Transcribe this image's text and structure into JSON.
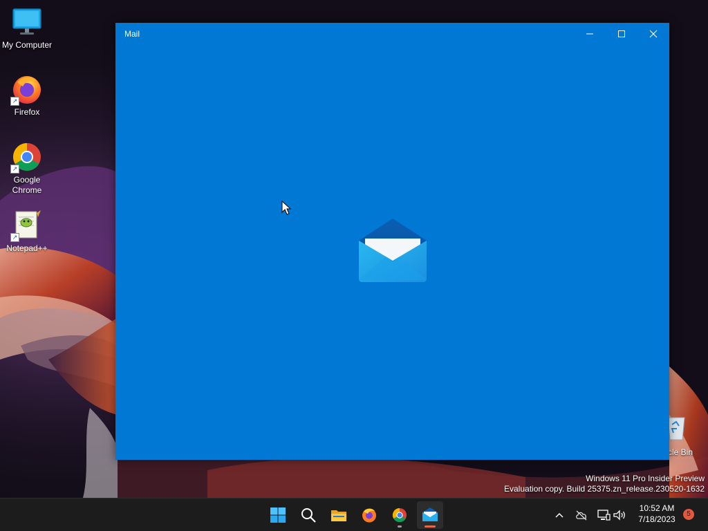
{
  "desktop": {
    "icons": [
      {
        "label": "My Computer",
        "icon": "monitor-icon"
      },
      {
        "label": "Firefox",
        "icon": "firefox-icon"
      },
      {
        "label": "Google\nChrome",
        "icon": "chrome-icon"
      },
      {
        "label": "Notepad++",
        "icon": "notepadpp-icon"
      }
    ],
    "recycle_bin_label": "ycle Bin"
  },
  "window": {
    "title": "Mail",
    "controls": [
      "minimize-icon",
      "maximize-icon",
      "close-icon"
    ],
    "background": "#0078d4"
  },
  "watermark": {
    "line1": "Windows 11 Pro Insider Preview",
    "line2": "Evaluation copy. Build 25375.zn_release.230520-1632"
  },
  "taskbar": {
    "apps": [
      "start-icon",
      "search-icon",
      "file-explorer-icon",
      "firefox-icon",
      "chrome-icon",
      "mail-icon"
    ],
    "active_app": "mail-icon",
    "clock": {
      "time": "10:52 AM",
      "date": "7/18/2023"
    },
    "notification_count": "5",
    "tray": [
      "chevron-up-icon",
      "cloud-offline-icon",
      "network-icon",
      "volume-icon"
    ]
  }
}
